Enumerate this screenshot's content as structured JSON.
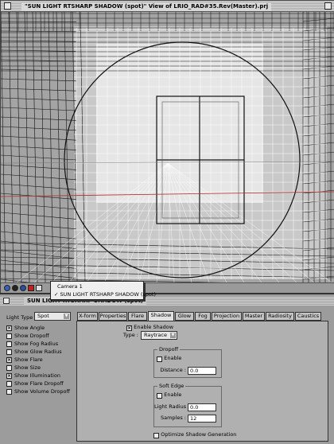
{
  "viewport": {
    "title": "\"SUN LIGHT RTSHARP SHADOW (spot)\" View of LRIO_RAD#35.Rev(Master).prj",
    "camera_menu": {
      "items": [
        "Camera 1",
        "✓ SUN LIGHT RTSHARP SHADOW (spot)"
      ],
      "selected": "SUN LIGHT RTSHARP SHADOW (spot)"
    },
    "toolbar_icons": [
      "camera-icon",
      "sphere-icon",
      "lock-icon",
      "close-icon",
      "pen-icon"
    ]
  },
  "panel": {
    "title": "SUN LIGHT RTSHARP SHADOW (spot)",
    "light_type_label": "Light Type :",
    "light_type_value": "Spot",
    "tabs": [
      "X-form",
      "Properties",
      "Flare",
      "Shadow",
      "Glow",
      "Fog",
      "Projection",
      "Master",
      "Radiosity",
      "Caustics"
    ],
    "active_tab": "Shadow",
    "show_options": [
      {
        "label": "Show Angle",
        "checked": true
      },
      {
        "label": "Show Dropoff",
        "checked": false
      },
      {
        "label": "Show Fog Radius",
        "checked": false
      },
      {
        "label": "Show Glow Radius",
        "checked": false
      },
      {
        "label": "Show Flare",
        "checked": true
      },
      {
        "label": "Show Size",
        "checked": false
      },
      {
        "label": "Show Illumination",
        "checked": true
      },
      {
        "label": "Show Flare Dropoff",
        "checked": false
      },
      {
        "label": "Show Volume Dropoff",
        "checked": false
      }
    ],
    "shadow": {
      "enable_shadow_label": "Enable Shadow",
      "enable_shadow_checked": true,
      "type_label": "Type :",
      "type_value": "Raytrace",
      "dropoff": {
        "title": "Dropoff",
        "enable_label": "Enable",
        "enable_checked": false,
        "distance_label": "Distance :",
        "distance_value": "0.0"
      },
      "soft_edge": {
        "title": "Soft Edge",
        "enable_label": "Enable",
        "enable_checked": false,
        "light_radius_label": "Light Radius :",
        "light_radius_value": "0.0",
        "samples_label": "Samples :",
        "samples_value": "12"
      },
      "optimize_label": "Optimize Shadow Generation",
      "optimize_checked": false
    }
  },
  "colors": {
    "viewport_bg": "#a4a4a4",
    "panel_bg": "#9c9c9c",
    "wire_dark": "#111111",
    "wire_light": "#ffffff",
    "axis_red": "#b03030"
  }
}
